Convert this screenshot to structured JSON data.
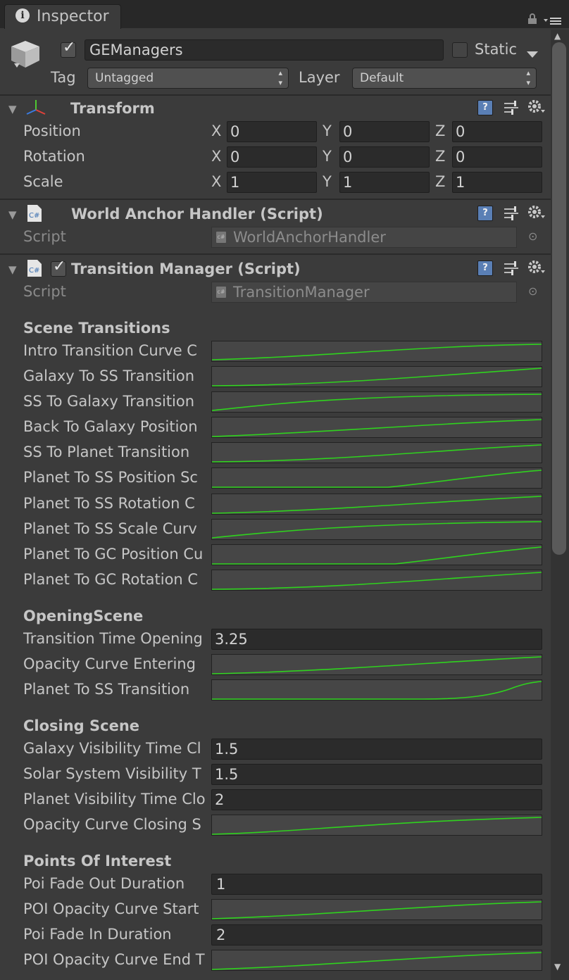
{
  "tab": {
    "label": "Inspector"
  },
  "gameobject": {
    "name": "GEManagers",
    "static_label": "Static",
    "tag_label": "Tag",
    "tag_value": "Untagged",
    "layer_label": "Layer",
    "layer_value": "Default"
  },
  "transform": {
    "title": "Transform",
    "axis_x": "X",
    "axis_y": "Y",
    "axis_z": "Z",
    "position_label": "Position",
    "position": {
      "x": "0",
      "y": "0",
      "z": "0"
    },
    "rotation_label": "Rotation",
    "rotation": {
      "x": "0",
      "y": "0",
      "z": "0"
    },
    "scale_label": "Scale",
    "scale": {
      "x": "1",
      "y": "1",
      "z": "1"
    }
  },
  "world_anchor": {
    "title": "World Anchor Handler (Script)",
    "script_label": "Script",
    "script_value": "WorldAnchorHandler"
  },
  "transition_manager": {
    "title": "Transition Manager (Script)",
    "script_label": "Script",
    "script_value": "TransitionManager",
    "scene_transitions": {
      "header": "Scene Transitions",
      "rows": [
        {
          "label": "Intro Transition Curve C"
        },
        {
          "label": "Galaxy To SS Transition"
        },
        {
          "label": "SS To Galaxy Transition"
        },
        {
          "label": "Back To Galaxy Position"
        },
        {
          "label": "SS To Planet Transition"
        },
        {
          "label": "Planet To SS Position Sc"
        },
        {
          "label": "Planet To SS Rotation C"
        },
        {
          "label": "Planet To SS Scale Curv"
        },
        {
          "label": "Planet To GC Position Cu"
        },
        {
          "label": "Planet To GC Rotation C"
        }
      ]
    },
    "opening_scene": {
      "header": "OpeningScene",
      "transition_time_label": "Transition Time Opening",
      "transition_time_value": "3.25",
      "opacity_curve_label": "Opacity Curve Entering",
      "planet_to_ss_label": "Planet To SS Transition"
    },
    "closing_scene": {
      "header": "Closing Scene",
      "galaxy_label": "Galaxy Visibility Time Cl",
      "galaxy_value": "1.5",
      "solar_label": "Solar System Visibility T",
      "solar_value": "1.5",
      "planet_label": "Planet Visibility Time Clo",
      "planet_value": "2",
      "opacity_label": "Opacity Curve Closing S"
    },
    "poi": {
      "header": "Points Of Interest",
      "fade_out_label": "Poi Fade Out Duration",
      "fade_out_value": "1",
      "curve_start_label": "POI Opacity Curve Start",
      "fade_in_label": "Poi Fade In Duration",
      "fade_in_value": "2",
      "curve_end_label": "POI Opacity Curve End T"
    }
  },
  "colors": {
    "curve": "#2fd21e",
    "background": "#3b3b3b",
    "field": "#2b2b2b"
  }
}
